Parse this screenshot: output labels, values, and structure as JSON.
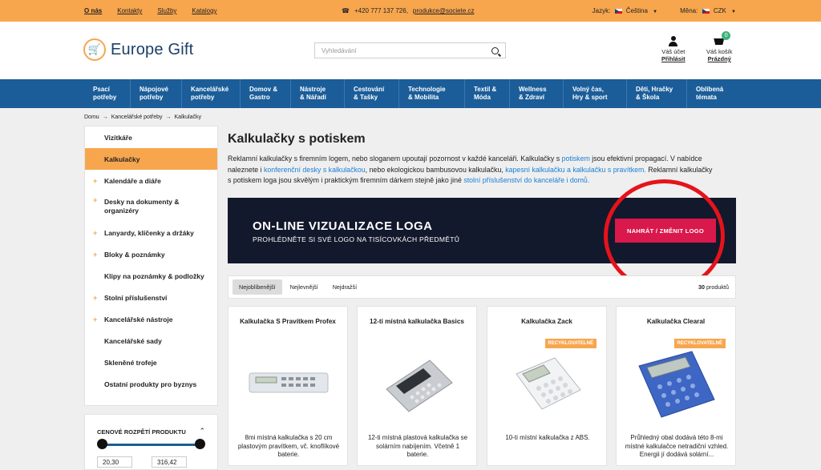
{
  "topbar": {
    "links": [
      "O nás",
      "Kontakty",
      "Služby",
      "Katalogy"
    ],
    "phone": "+420 777 137 726,",
    "email": "produkce@societe.cz",
    "language_label": "Jazyk:",
    "language_value": "Čeština",
    "currency_label": "Měna:",
    "currency_value": "CZK"
  },
  "header": {
    "logo_text": "Europe Gift",
    "search_placeholder": "Vyhledávání",
    "account_label": "Váš účet",
    "account_link": "Přihlásit",
    "cart_label": "Váš košík",
    "cart_link": "Prázdný",
    "cart_count": "0"
  },
  "nav": [
    "Psací\npotřeby",
    "Nápojové\npotřeby",
    "Kancelářské\npotřeby",
    "Domov &\nGastro",
    "Nástroje\n& Nářadí",
    "Cestování\n& Tašky",
    "Technologie\n& Mobilita",
    "Textil &\nMóda",
    "Wellness\n& Zdraví",
    "Volný čas,\nHry & sport",
    "Děti, Hračky\n& Škola",
    "Oblíbená\ntémata"
  ],
  "breadcrumb": [
    "Domu",
    "Kancelářské potřeby",
    "Kalkulačky"
  ],
  "sidebar": {
    "items": [
      {
        "label": "Vizitkáře",
        "plus": false
      },
      {
        "label": "Kalkulačky",
        "plus": false,
        "active": true
      },
      {
        "label": "Kalendáře a diáře",
        "plus": true
      },
      {
        "label": "Desky na dokumenty & organizéry",
        "plus": true
      },
      {
        "label": "Lanyardy, klíčenky a držáky",
        "plus": true
      },
      {
        "label": "Bloky & poznámky",
        "plus": true
      },
      {
        "label": "Klipy na poznámky & podložky",
        "plus": false
      },
      {
        "label": "Stolní příslušenství",
        "plus": true
      },
      {
        "label": "Kancelářské nástroje",
        "plus": true
      },
      {
        "label": "Kancelářské sady",
        "plus": false
      },
      {
        "label": "Skleněné trofeje",
        "plus": false
      },
      {
        "label": "Ostatní produkty pro byznys",
        "plus": false
      }
    ]
  },
  "price_filter": {
    "title": "CENOVÉ ROZPĚTÍ PRODUKTU",
    "min": "20,30",
    "max": "316,42",
    "range_fraction": [
      0.0,
      1.0
    ]
  },
  "page": {
    "title": "Kalkulačky s potiskem",
    "desc_1": "Reklamní kalkulačky s firemním logem, nebo sloganem upoutají pozornost v každé kanceláři. Kalkulačky s ",
    "desc_link_1": "potiskem",
    "desc_2": " jsou efektivní propagací. V nabídce naleznete i ",
    "desc_link_2": "konferenční desky s kalkulačkou",
    "desc_3": ", nebo ekologickou bambusovou kalkulačku, ",
    "desc_link_3": "kapesní kalkulačku a kalkulačku s pravítkem.",
    "desc_4": " Reklamní kalkulačky s potiskem loga jsou skvělým i praktickým firemním dárkem stejně jako jiné ",
    "desc_link_4": "stolní příslušenství do kanceláře i domů."
  },
  "banner": {
    "title": "ON-LINE VIZUALIZACE LOGA",
    "subtitle": "PROHLÉDNĚTE SI SVÉ LOGO NA TISÍCOVKÁCH PŘEDMĚTŮ",
    "button": "NAHRÁT / ZMĚNIT LOGO"
  },
  "sort": {
    "tabs": [
      "Nejoblíbenější",
      "Nejlevnější",
      "Nejdražší"
    ],
    "selected": 0,
    "count": "30",
    "count_suffix": "produktů"
  },
  "products": [
    {
      "title": "Kalkulačka S Pravítkem Profex",
      "desc": "8mi místná kalkulačka s 20 cm plastovým pravítkem, vč. knoflíkové baterie.",
      "tag": ""
    },
    {
      "title": "12-ti místná kalkulačka Basics",
      "desc": "12-ti místná plastová kalkulačka se solárním nabíjením. Včetně 1 baterie.",
      "tag": ""
    },
    {
      "title": "Kalkulačka Zack",
      "desc": "10-ti místní kalkulačka z ABS.",
      "tag": "RECYKLOVATELNÉ"
    },
    {
      "title": "Kalkulačka Clearal",
      "desc": "Průhledný obal dodává této 8-mi místné kalkulačce netradiční vzhled. Energii jí dodává solární...",
      "tag": "RECYKLOVATELNÉ"
    }
  ],
  "colors": {
    "accent": "#f7a64e",
    "nav": "#1b5d99",
    "banner": "#13192c",
    "cta": "#d9184b",
    "highlight_ring": "#e5131c"
  }
}
